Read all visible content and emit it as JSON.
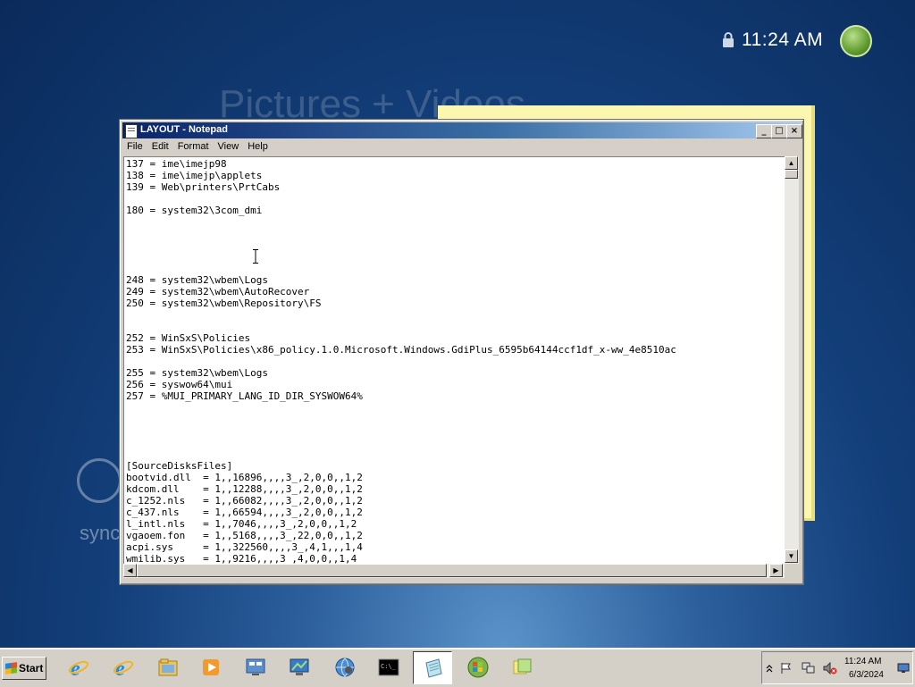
{
  "desktop": {
    "clock": "11:24 AM",
    "background_heading": "Pictures + Videos",
    "sync_label": "sync"
  },
  "notepad": {
    "title": "LAYOUT - Notepad",
    "menu": [
      "File",
      "Edit",
      "Format",
      "View",
      "Help"
    ],
    "lines": [
      "137 = ime\\imejp98",
      "138 = ime\\imejp\\applets",
      "139 = Web\\printers\\PrtCabs",
      "",
      "180 = system32\\3com_dmi",
      "",
      "",
      "",
      "",
      "",
      "248 = system32\\wbem\\Logs",
      "249 = system32\\wbem\\AutoRecover",
      "250 = system32\\wbem\\Repository\\FS",
      "",
      "",
      "252 = WinSxS\\Policies",
      "253 = WinSxS\\Policies\\x86_policy.1.0.Microsoft.Windows.GdiPlus_6595b64144ccf1df_x-ww_4e8510ac",
      "",
      "255 = system32\\wbem\\Logs",
      "256 = syswow64\\mui",
      "257 = %MUI_PRIMARY_LANG_ID_DIR_SYSWOW64%",
      "",
      "",
      "",
      "",
      "",
      "[SourceDisksFiles]",
      "bootvid.dll  = 1,,16896,,,,3_,2,0,0,,1,2",
      "kdcom.dll    = 1,,12288,,,,3_,2,0,0,,1,2",
      "c_1252.nls   = 1,,66082,,,,3_,2,0,0,,1,2",
      "c_437.nls    = 1,,66594,,,,3_,2,0,0,,1,2",
      "l_intl.nls   = 1,,7046,,,,3_,2,0,0,,1,2",
      "vgaoem.fon   = 1,,5168,,,,3_,22,0,0,,1,2",
      "acpi.sys     = 1,,322560,,,,3_,4,1,,,1,4",
      "wmilib.sys   = 1,,9216,,,,3_,4,0,0,,1,4"
    ]
  },
  "taskbar": {
    "start_label": "Start",
    "apps": [
      {
        "name": "Internet Explorer",
        "icon": "ie-icon"
      },
      {
        "name": "Internet Explorer",
        "icon": "ie-icon"
      },
      {
        "name": "Windows Explorer",
        "icon": "folder-icon"
      },
      {
        "name": "Media Player",
        "icon": "media-player-icon"
      },
      {
        "name": "Control Panel",
        "icon": "control-panel-icon"
      },
      {
        "name": "Remote Desktop",
        "icon": "remote-desktop-icon"
      },
      {
        "name": "Network",
        "icon": "globe-icon"
      },
      {
        "name": "Command Prompt",
        "icon": "cmd-icon"
      },
      {
        "name": "Notepad",
        "icon": "notepad-icon",
        "active": true
      },
      {
        "name": "Windows",
        "icon": "windows-orb-icon"
      },
      {
        "name": "Sticky Notes",
        "icon": "sticky-notes-icon"
      }
    ],
    "tray": {
      "time": "11:24 AM",
      "date": "6/3/2024"
    }
  }
}
